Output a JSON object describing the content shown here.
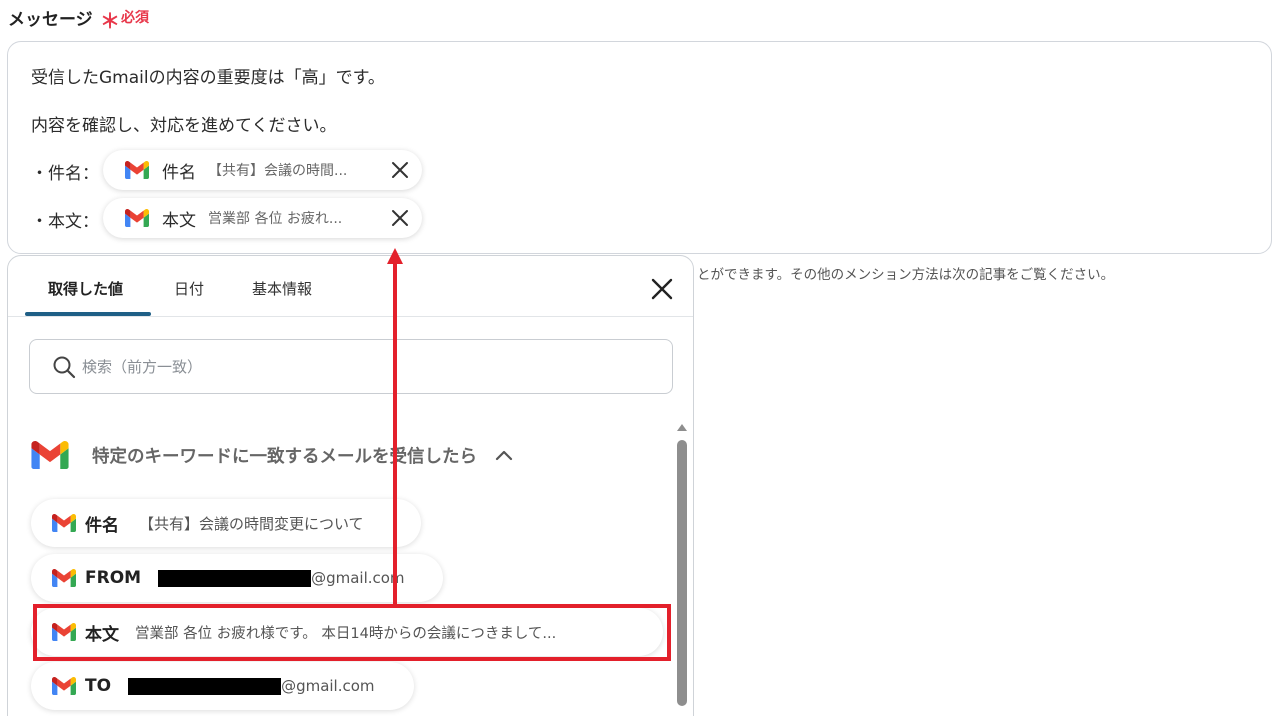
{
  "field": {
    "label": "メッセージ",
    "required_mark": "＊",
    "required_text": "必須"
  },
  "message": {
    "line1": "受信したGmailの内容の重要度は「高」です。",
    "line2": "内容を確認し、対応を進めてください。",
    "subject_label": "・件名：",
    "body_label": "・本文："
  },
  "chips": [
    {
      "name": "件名",
      "value": "【共有】会議の時間..."
    },
    {
      "name": "本文",
      "value": "営業部 各位 お疲れ..."
    }
  ],
  "help_text": "とができます。その他のメンション方法は次の記事をご覧ください。",
  "panel": {
    "tabs": [
      "取得した値",
      "日付",
      "基本情報"
    ],
    "search_placeholder": "検索（前方一致）",
    "group_title": "特定のキーワードに一致するメールを受信したら",
    "options": [
      {
        "name": "件名",
        "value": "【共有】会議の時間変更について"
      },
      {
        "name": "FROM",
        "value": "@gmail.com"
      },
      {
        "name": "本文",
        "value": "営業部 各位 お疲れ様です。 本日14時からの会議につきまして..."
      },
      {
        "name": "TO",
        "value": "@gmail.com"
      }
    ]
  },
  "colors": {
    "required": "#e8374a",
    "tab_underline": "#1f5f86",
    "highlight": "#e3202b"
  }
}
